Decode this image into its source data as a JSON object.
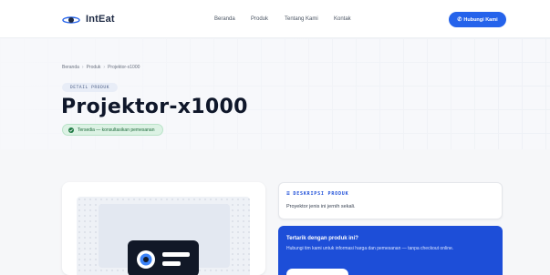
{
  "brand": {
    "name": "IntEat",
    "icon": "intercom-logo-icon",
    "accent": "#2563eb"
  },
  "nav": {
    "items": [
      {
        "label": "Beranda"
      },
      {
        "label": "Produk"
      },
      {
        "label": "Tentang Kami"
      },
      {
        "label": "Kontak"
      }
    ]
  },
  "cta": {
    "label": "Hubungi Kami",
    "icon": "phone-icon"
  },
  "hero": {
    "breadcrumb": [
      "Beranda",
      "Produk",
      "Projektor-x1000"
    ],
    "breadcrumb_separator": "›",
    "tag": "DETAIL PRODUK",
    "title": "Projektor-x1000",
    "status": "Tersedia — konsultasikan pemesanan",
    "status_color": "#1f7a44"
  },
  "description": {
    "title": "DESKRIPSI PRODUK",
    "icon": "list-icon",
    "text": "Proyektor jenis ini jernih sekali."
  },
  "promo": {
    "title": "Tertarik dengan produk ini?",
    "text": "Hubungi tim kami untuk informasi harga dan pemesanan — tanpa checkout online.",
    "background": "#1d4ed8"
  },
  "product_image": {
    "icon": "projector-icon"
  }
}
